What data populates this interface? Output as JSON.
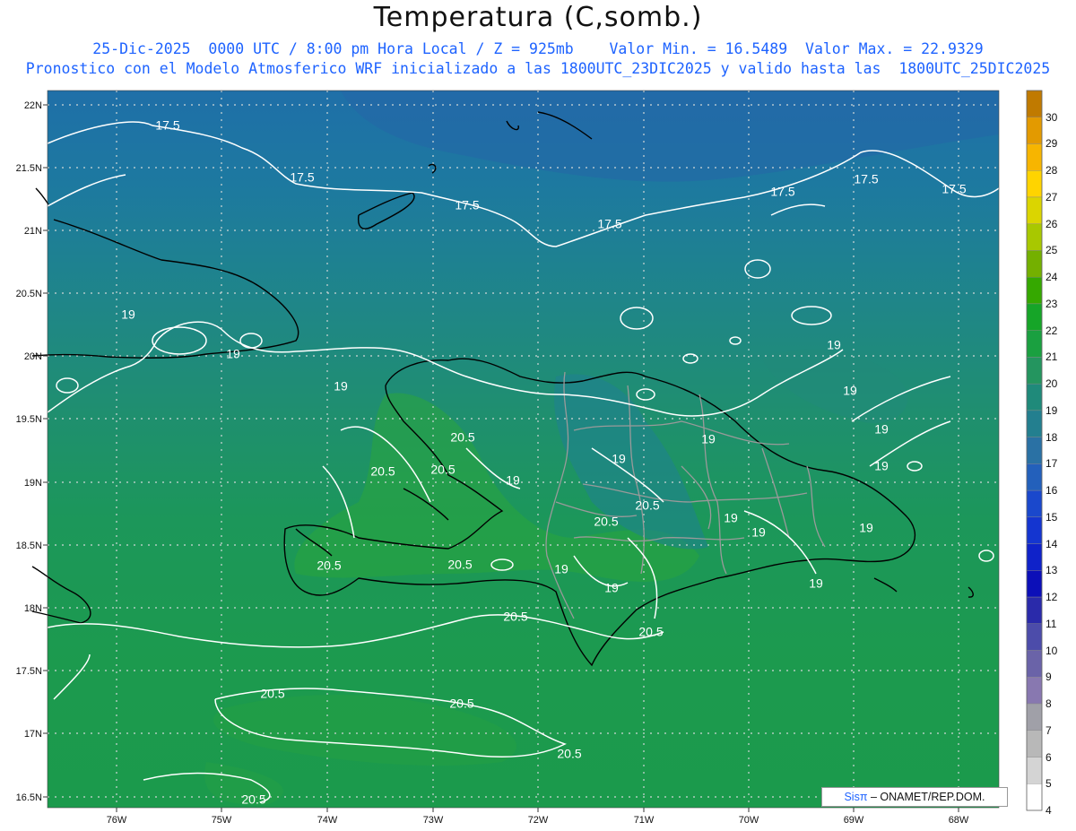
{
  "title": "Temperatura (C,somb.)",
  "subtitle_line1": "25-Dic-2025  0000 UTC / 8:00 pm Hora Local / Z = 925mb    Valor Min. = 16.5489  Valor Max. = 22.9329",
  "subtitle_line2": "Pronostico con el Modelo Atmosferico WRF inicializado a las 1800UTC_23DIC2025 y valido hasta las  1800UTC_25DIC2025",
  "credit": {
    "brand": "Sisπ",
    "text": "– ONAMET/REP.DOM."
  },
  "lat_labels": [
    "22N",
    "21.5N",
    "21N",
    "20.5N",
    "20N",
    "19.5N",
    "19N",
    "18.5N",
    "18N",
    "17.5N",
    "17N",
    "16.5N"
  ],
  "lon_labels": [
    "76W",
    "75W",
    "74W",
    "73W",
    "72W",
    "71W",
    "70W",
    "69W",
    "68W"
  ],
  "colorbar": {
    "labels": [
      "30",
      "29",
      "28",
      "27",
      "26",
      "25",
      "24",
      "23",
      "22",
      "21",
      "20",
      "19",
      "18",
      "17",
      "16",
      "15",
      "14",
      "13",
      "12",
      "11",
      "10",
      "9",
      "8",
      "7",
      "6",
      "5",
      "4"
    ],
    "colors": [
      "#c07a00",
      "#e39a00",
      "#f7b500",
      "#ffd400",
      "#dbd500",
      "#a8c800",
      "#74b000",
      "#35a800",
      "#16a528",
      "#1aa040",
      "#24955f",
      "#1f8a7a",
      "#237f8f",
      "#2a71a4",
      "#2360bb",
      "#1a48cc",
      "#1435d0",
      "#0f22c9",
      "#0c0fb8",
      "#2a2aaa",
      "#4c4caa",
      "#6a63a8",
      "#8878b0",
      "#a0a0a8",
      "#b8b8b8",
      "#d4d4d4",
      "#ffffff"
    ]
  },
  "contour_labels": [
    "17.5",
    "19",
    "20.5"
  ],
  "colors": {
    "subtitle": "#1e63ff",
    "contour": "#ffffff",
    "coastline": "#000000",
    "border": "#9a9a9a"
  }
}
